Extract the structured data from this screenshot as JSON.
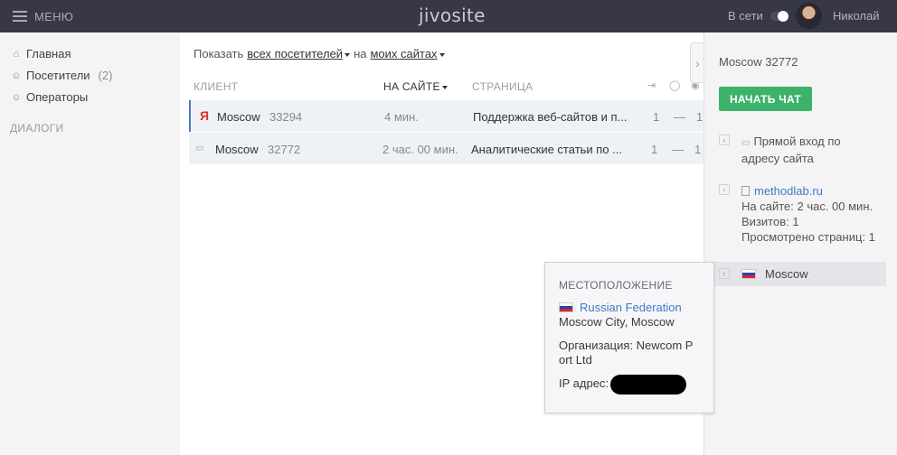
{
  "topbar": {
    "menu_label": "МЕНЮ",
    "logo": "jivosite",
    "status_label": "В сети",
    "user_name": "Николай"
  },
  "sidebar": {
    "items": [
      {
        "label": "Главная",
        "icon": "home-icon"
      },
      {
        "label": "Посетители",
        "count": "(2)",
        "icon": "users-icon"
      },
      {
        "label": "Операторы",
        "icon": "user-icon"
      }
    ],
    "section_title": "ДИАЛОГИ"
  },
  "filter": {
    "show_label": "Показать",
    "visitors_select": "всех посетителей",
    "on_label": "на",
    "sites_select": "моих сайтах"
  },
  "table": {
    "columns": [
      "КЛИЕНТ",
      "НА САЙТЕ",
      "СТРАНИЦА"
    ],
    "column_icons": [
      "enter-icon",
      "chat-bubble-icon",
      "eye-icon"
    ],
    "rows": [
      {
        "source": "Я",
        "city": "Moscow",
        "id": "33294",
        "time": "4 мин.",
        "page": "Поддержка веб-сайтов и п...",
        "c1": "1",
        "c2": "—",
        "c3": "1"
      },
      {
        "source": "direct",
        "city": "Moscow",
        "id": "32772",
        "time": "2 час. 00 мин.",
        "page": "Аналитические статьи по ...",
        "c1": "1",
        "c2": "—",
        "c3": "1"
      }
    ]
  },
  "details": {
    "title": "Moscow 32772",
    "start_chat": "НАЧАТЬ ЧАТ",
    "referrer": {
      "line1": "Прямой вход по",
      "line2": "адресу сайта"
    },
    "site": {
      "link": "methodlab.ru",
      "time_on_site": "На сайте: 2 час. 00 мин.",
      "visits": "Визитов: 1",
      "pages_viewed": "Просмотрено страниц: 1"
    },
    "location": "Moscow"
  },
  "popup": {
    "title": "МЕСТОПОЛОЖЕНИЕ",
    "country": "Russian Federation",
    "city": "Moscow City, Moscow",
    "org_line1": "Организация: Newcom P",
    "org_line2": "ort Ltd",
    "ip_label": "IP адрес:"
  },
  "colors": {
    "topbar": "#373745",
    "accent_green": "#3db26b",
    "link_blue": "#3f7bc3",
    "selected_border": "#4a7cc7"
  }
}
